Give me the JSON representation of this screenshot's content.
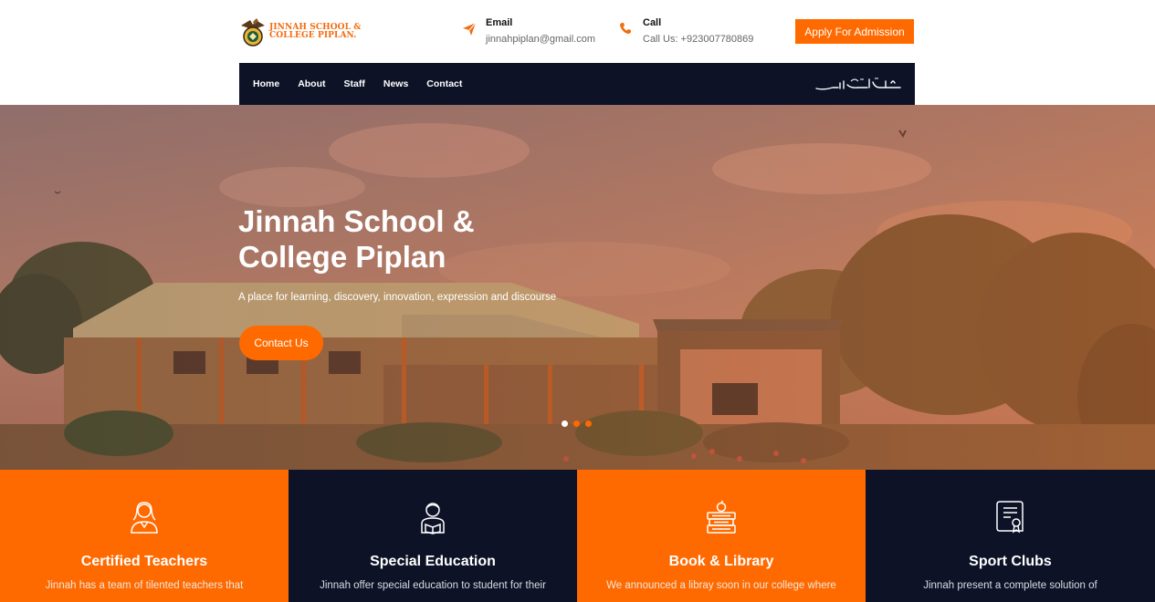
{
  "logo": {
    "line1": "JINNAH SCHOOL &",
    "line2": "COLLEGE PIPLAN."
  },
  "contact": {
    "email_label": "Email",
    "email_value": "jinnahpiplan@gmail.com",
    "call_label": "Call",
    "call_value": "Call Us: +923007780869"
  },
  "apply_label": "Apply For Admission",
  "nav": {
    "items": [
      {
        "label": "Home"
      },
      {
        "label": "About"
      },
      {
        "label": "Staff"
      },
      {
        "label": "News"
      },
      {
        "label": "Contact"
      }
    ]
  },
  "hero": {
    "title_line1": "Jinnah School &",
    "title_line2": "College Piplan",
    "subtitle": "A place for learning, discovery, innovation, expression and discourse",
    "button": "Contact Us",
    "slides": 3,
    "active_slide": 1
  },
  "features": [
    {
      "title": "Certified Teachers",
      "desc": "Jinnah has a team of tilented teachers that",
      "icon": "teacher-icon"
    },
    {
      "title": "Special Education",
      "desc": "Jinnah offer special education to student for their",
      "icon": "student-reading-icon"
    },
    {
      "title": "Book & Library",
      "desc": "We announced a libray soon in our college where",
      "icon": "books-apple-icon"
    },
    {
      "title": "Sport Clubs",
      "desc": "Jinnah present a complete solution of",
      "icon": "certificate-icon"
    }
  ],
  "colors": {
    "accent": "#ff6a00",
    "navy": "#0d1227"
  }
}
